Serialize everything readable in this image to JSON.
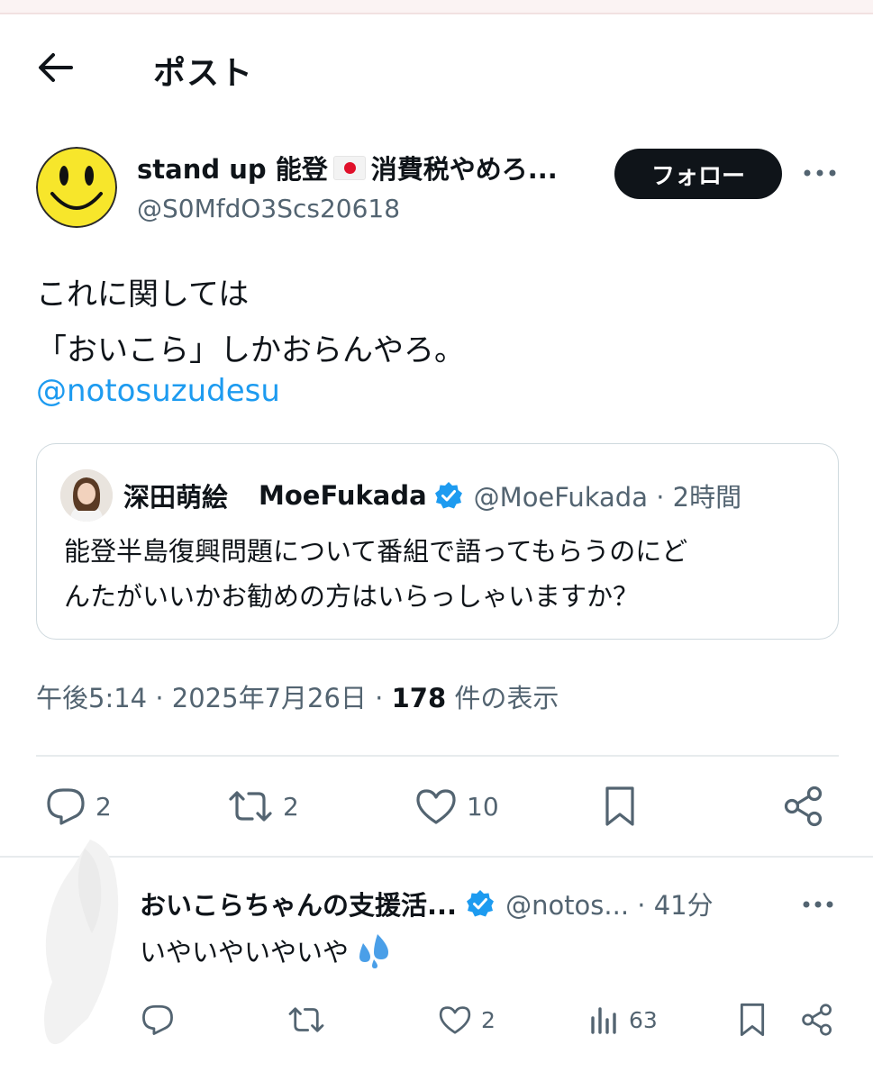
{
  "header": {
    "title": "ポスト"
  },
  "post": {
    "author_name_part1": "stand up 能登",
    "author_name_part2": "消費税やめろ...",
    "author_handle": "@S0MfdO3Scs20618",
    "follow_label": "フォロー",
    "text_lines": [
      "これに関しては",
      "「おいこら」しかおらんやろ。"
    ],
    "mention": "@notosuzudesu",
    "quote": {
      "name": "深田萌絵",
      "name2": "MoeFukada",
      "handle_time": "@MoeFukada · 2時間",
      "text_lines": [
        "能登半島復興問題について番組で語ってもらうのにど",
        "んたがいいかお勧めの方はいらっしゃいますか？"
      ]
    },
    "meta_time": "午後5:14 · 2025年7月26日 · ",
    "meta_views_count": "178",
    "meta_views_label": " 件の表示",
    "actions": {
      "replies": "2",
      "reposts": "2",
      "likes": "10"
    }
  },
  "reply": {
    "name": "おいこらちゃんの支援活...",
    "handle_time": "@notos... · 41分",
    "text": "いやいやいやいや",
    "actions": {
      "likes": "2",
      "views": "63"
    }
  },
  "colors": {
    "accent": "#1d9bf0",
    "text": "#0f1419",
    "muted": "#536471",
    "border": "#cfd9de"
  },
  "icons": [
    "back-arrow-icon",
    "smiley-avatar-icon",
    "more-dots-icon",
    "verified-badge-icon",
    "reply-icon",
    "repost-icon",
    "like-icon",
    "bookmark-icon",
    "share-icon",
    "views-icon",
    "sweat-drops-icon"
  ]
}
